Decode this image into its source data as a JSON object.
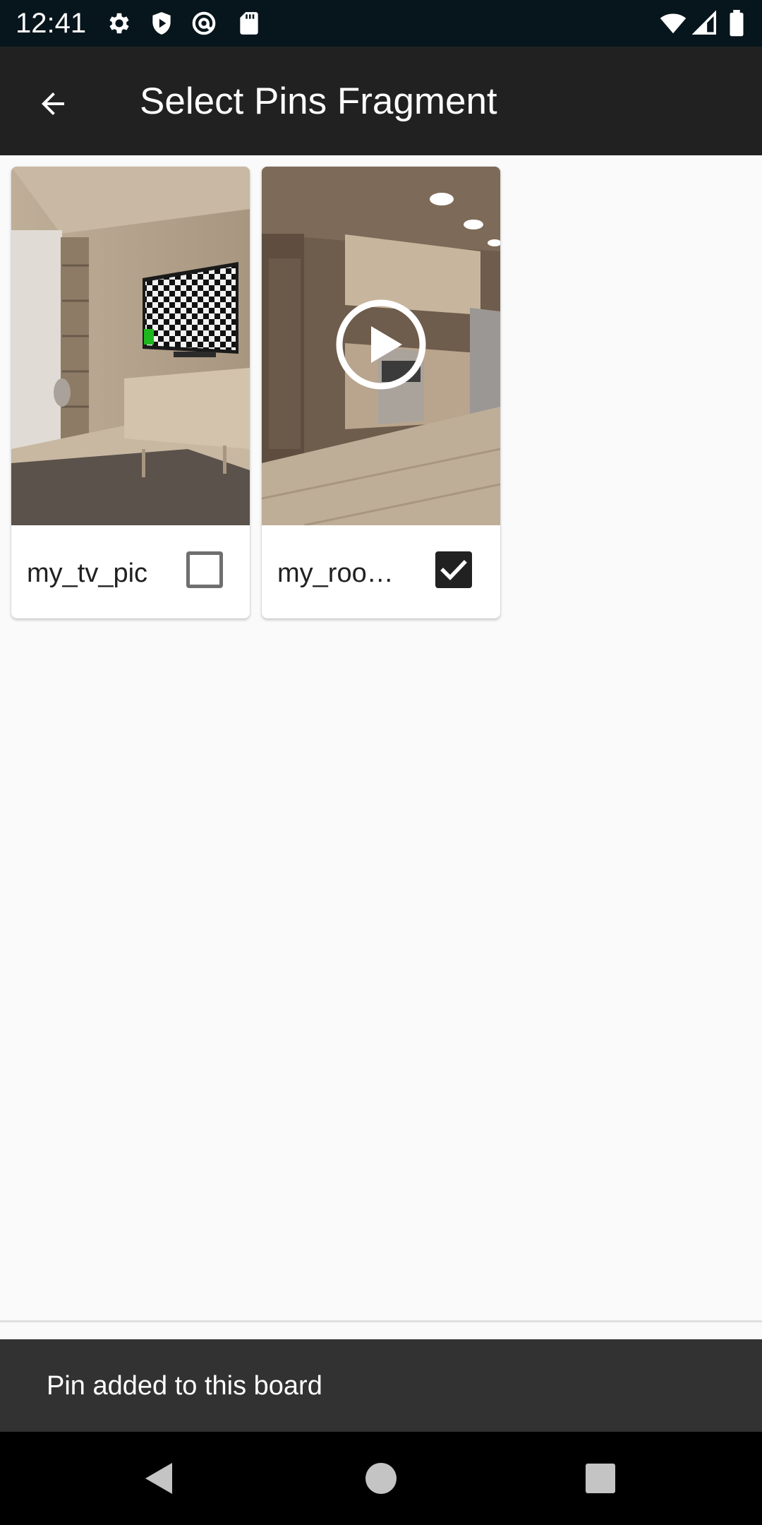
{
  "status_bar": {
    "time": "12:41",
    "left_icons": [
      "settings-icon",
      "shield-icon",
      "at-sign-icon",
      "sd-card-icon"
    ],
    "right_icons": [
      "wifi-icon",
      "cell-signal-icon",
      "battery-icon"
    ]
  },
  "app_bar": {
    "back_icon": "arrow-left-icon",
    "title": "Select Pins Fragment"
  },
  "pins": [
    {
      "label": "my_tv_pic",
      "selected": false,
      "is_video": false,
      "thumbnail": "living-room-tv-image"
    },
    {
      "label": "my_roo…",
      "selected": true,
      "is_video": true,
      "thumbnail": "kitchen-room-video"
    }
  ],
  "snackbar": {
    "message": "Pin added to this board"
  },
  "nav_bar": {
    "buttons": [
      "back-triangle-icon",
      "home-circle-icon",
      "recents-square-icon"
    ]
  },
  "colors": {
    "status_bar": "#07151c",
    "app_bar": "#212121",
    "background": "#fafafa",
    "snackbar": "#323232",
    "nav_bar": "#000000"
  }
}
